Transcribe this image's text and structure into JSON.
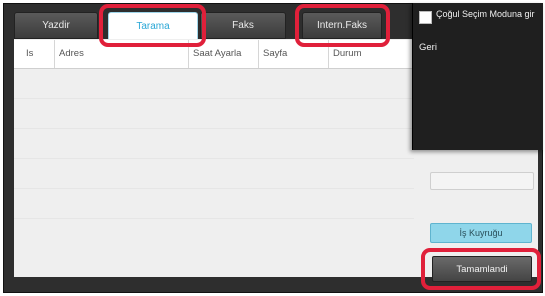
{
  "tabs": [
    {
      "label": "Yazdir",
      "active": false
    },
    {
      "label": "Tarama",
      "active": true
    },
    {
      "label": "Faks",
      "active": false
    },
    {
      "label": "Intern.Faks",
      "active": false
    }
  ],
  "table": {
    "columns": [
      "Is",
      "Adres",
      "Saat Ayarla",
      "Sayfa",
      "Durum"
    ]
  },
  "menu": {
    "multi_select_label": "Çoğul Seçim Moduna gir",
    "multi_select_checked": false,
    "back_label": "Geri"
  },
  "buttons": {
    "job_queue": "İş Kuyruğu",
    "completed": "Tamamlandi"
  },
  "colors": {
    "highlight": "#e0203a",
    "active_tab_text": "#2aa7d6",
    "queue_button": "#8fd6ea"
  }
}
